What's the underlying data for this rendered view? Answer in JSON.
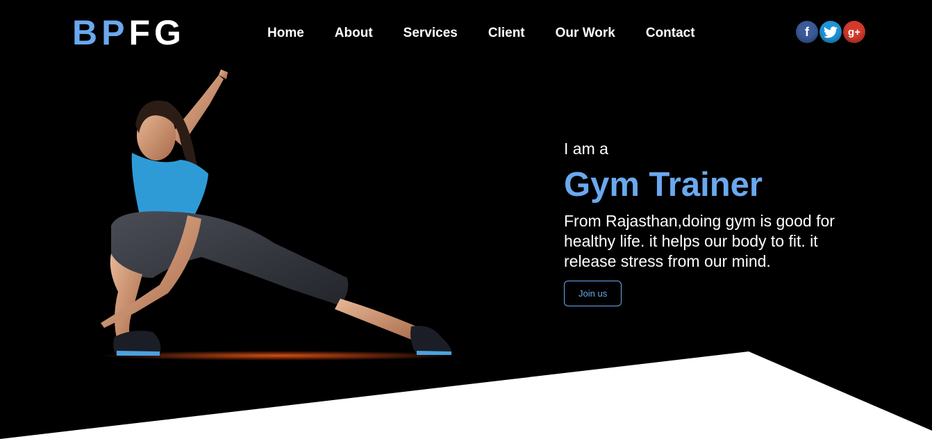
{
  "brand": {
    "part1": "BP",
    "part2": "FG",
    "accent": "#6aa9ee"
  },
  "nav": {
    "items": [
      "Home",
      "About",
      "Services",
      "Client",
      "Our Work",
      "Contact"
    ]
  },
  "social": {
    "facebook": "f",
    "twitter": "🐦",
    "google": "g+"
  },
  "hero": {
    "intro": "I am a",
    "role": "Gym Trainer",
    "description": "From Rajasthan,doing gym is good for healthy life. it helps our body to fit. it release stress from our mind.",
    "cta": "Join us"
  }
}
